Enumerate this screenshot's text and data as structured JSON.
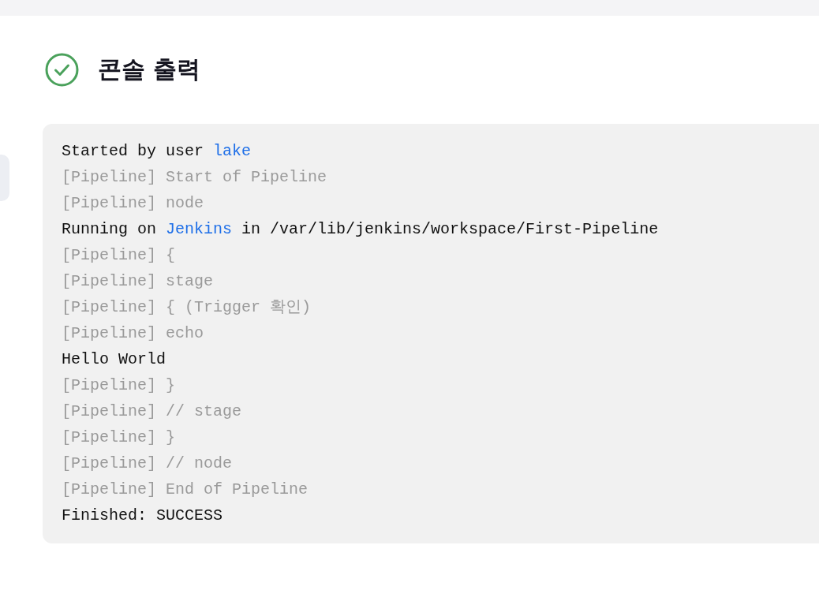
{
  "header": {
    "title": "콘솔 출력",
    "succeeded": true
  },
  "console": {
    "lines": [
      {
        "kind": "output",
        "segments": [
          {
            "kind": "text",
            "text": "Started by user "
          },
          {
            "kind": "link",
            "text": "lake"
          }
        ]
      },
      {
        "kind": "pipeline",
        "segments": [
          {
            "kind": "text",
            "text": "[Pipeline] Start of Pipeline"
          }
        ]
      },
      {
        "kind": "pipeline",
        "segments": [
          {
            "kind": "text",
            "text": "[Pipeline] node"
          }
        ]
      },
      {
        "kind": "output",
        "segments": [
          {
            "kind": "text",
            "text": "Running on "
          },
          {
            "kind": "link",
            "text": "Jenkins"
          },
          {
            "kind": "text",
            "text": " in /var/lib/jenkins/workspace/First-Pipeline"
          }
        ]
      },
      {
        "kind": "pipeline",
        "segments": [
          {
            "kind": "text",
            "text": "[Pipeline] {"
          }
        ]
      },
      {
        "kind": "pipeline",
        "segments": [
          {
            "kind": "text",
            "text": "[Pipeline] stage"
          }
        ]
      },
      {
        "kind": "pipeline",
        "segments": [
          {
            "kind": "text",
            "text": "[Pipeline] { (Trigger 확인)"
          }
        ]
      },
      {
        "kind": "pipeline",
        "segments": [
          {
            "kind": "text",
            "text": "[Pipeline] echo"
          }
        ]
      },
      {
        "kind": "output",
        "segments": [
          {
            "kind": "text",
            "text": "Hello World"
          }
        ]
      },
      {
        "kind": "pipeline",
        "segments": [
          {
            "kind": "text",
            "text": "[Pipeline] }"
          }
        ]
      },
      {
        "kind": "pipeline",
        "segments": [
          {
            "kind": "text",
            "text": "[Pipeline] // stage"
          }
        ]
      },
      {
        "kind": "pipeline",
        "segments": [
          {
            "kind": "text",
            "text": "[Pipeline] }"
          }
        ]
      },
      {
        "kind": "pipeline",
        "segments": [
          {
            "kind": "text",
            "text": "[Pipeline] // node"
          }
        ]
      },
      {
        "kind": "pipeline",
        "segments": [
          {
            "kind": "text",
            "text": "[Pipeline] End of Pipeline"
          }
        ]
      },
      {
        "kind": "output",
        "segments": [
          {
            "kind": "text",
            "text": "Finished: SUCCESS"
          }
        ]
      }
    ]
  }
}
